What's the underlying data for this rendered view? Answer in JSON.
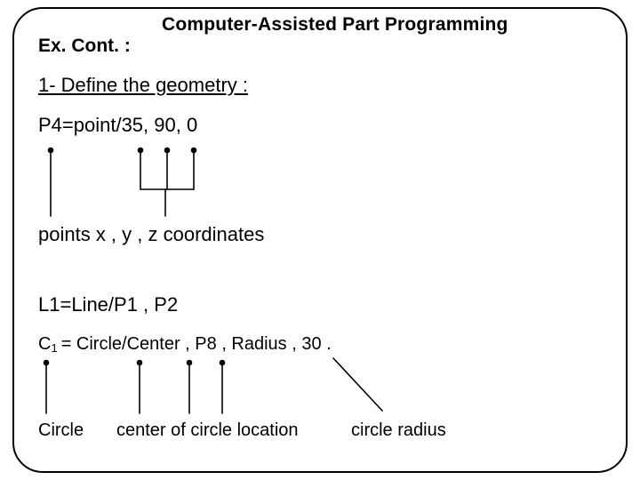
{
  "title": "Computer-Assisted Part Programming",
  "ex": "Ex. Cont. :",
  "step1": "1- Define the geometry :",
  "p4": "P4=point/35, 90, 0",
  "coords_caption": "points x , y , z coordinates",
  "l1": "L1=Line/P1 , P2",
  "c1": {
    "c": "C",
    "sub": "1",
    "rest": "= Circle/Center , P8 , Radius , 30 ."
  },
  "labels": {
    "circle": "Circle",
    "center": "center of circle location",
    "radius": "circle radius"
  }
}
